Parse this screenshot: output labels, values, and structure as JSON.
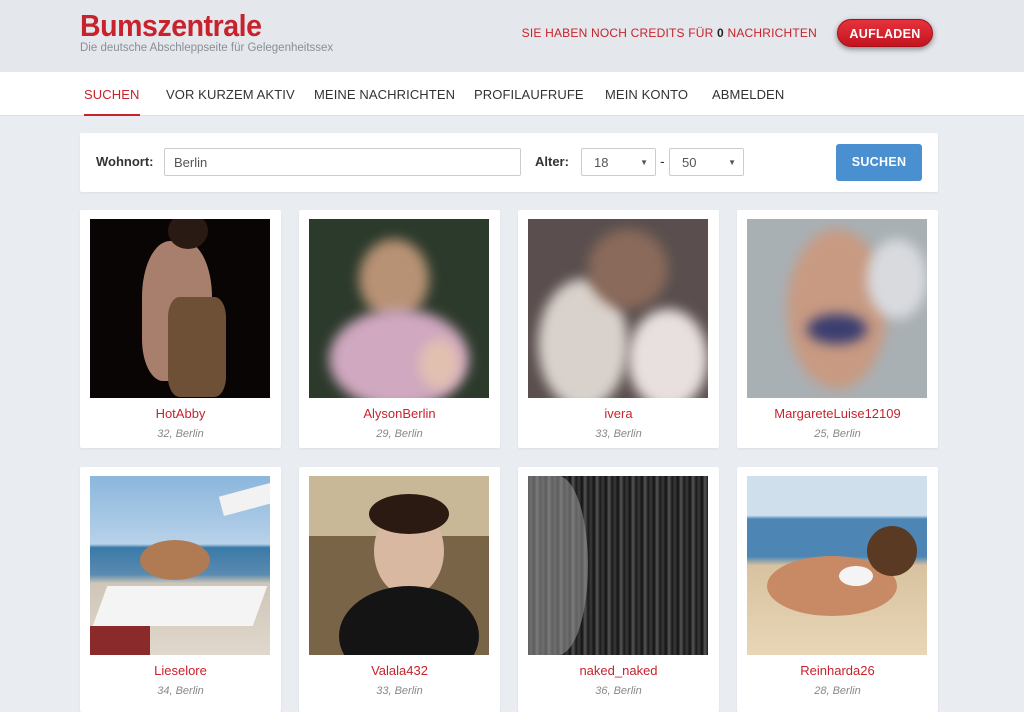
{
  "header": {
    "logo": "Bumszentrale",
    "tagline": "Die deutsche Abschleppseite für Gelegenheitssex",
    "credits_prefix": "SIE HABEN NOCH CREDITS FÜR ",
    "credits_count": "0",
    "credits_suffix": " NACHRICHTEN",
    "reload_label": "AUFLADEN"
  },
  "nav": {
    "items": [
      "SUCHEN",
      "VOR KURZEM AKTIV",
      "MEINE NACHRICHTEN",
      "PROFILAUFRUFE",
      "MEIN KONTO",
      "ABMELDEN"
    ]
  },
  "search": {
    "location_label": "Wohnort:",
    "location_value": "Berlin",
    "age_label": "Alter:",
    "age_min": "18",
    "age_max": "50",
    "age_separator": "-",
    "button_label": "SUCHEN"
  },
  "profiles": [
    {
      "name": "HotAbby",
      "meta": "32, Berlin"
    },
    {
      "name": "AlysonBerlin",
      "meta": "29, Berlin"
    },
    {
      "name": "ivera",
      "meta": "33, Berlin"
    },
    {
      "name": "MargareteLuise12109",
      "meta": "25, Berlin"
    },
    {
      "name": "Lieselore",
      "meta": "34, Berlin"
    },
    {
      "name": "Valala432",
      "meta": "33, Berlin"
    },
    {
      "name": "naked_naked",
      "meta": "36, Berlin"
    },
    {
      "name": "Reinharda26",
      "meta": "28, Berlin"
    }
  ]
}
